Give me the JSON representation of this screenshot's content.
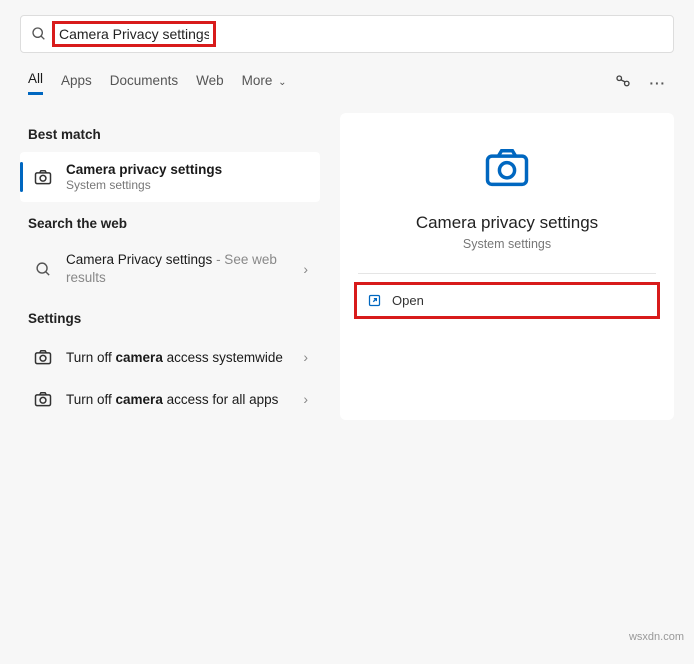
{
  "search": {
    "value": "Camera Privacy settings"
  },
  "tabs": {
    "all": "All",
    "apps": "Apps",
    "documents": "Documents",
    "web": "Web",
    "more": "More"
  },
  "sections": {
    "best_match": "Best match",
    "search_web": "Search the web",
    "settings": "Settings"
  },
  "best_match_item": {
    "title": "Camera privacy settings",
    "subtitle": "System settings"
  },
  "web_item": {
    "title": "Camera Privacy settings",
    "suffix": " - See web results"
  },
  "settings_items": [
    {
      "pre": "Turn off ",
      "bold": "camera",
      "post": " access systemwide"
    },
    {
      "pre": "Turn off ",
      "bold": "camera",
      "post": " access for all apps"
    }
  ],
  "preview": {
    "title": "Camera privacy settings",
    "subtitle": "System settings",
    "open": "Open"
  },
  "watermark": "wsxdn.com"
}
